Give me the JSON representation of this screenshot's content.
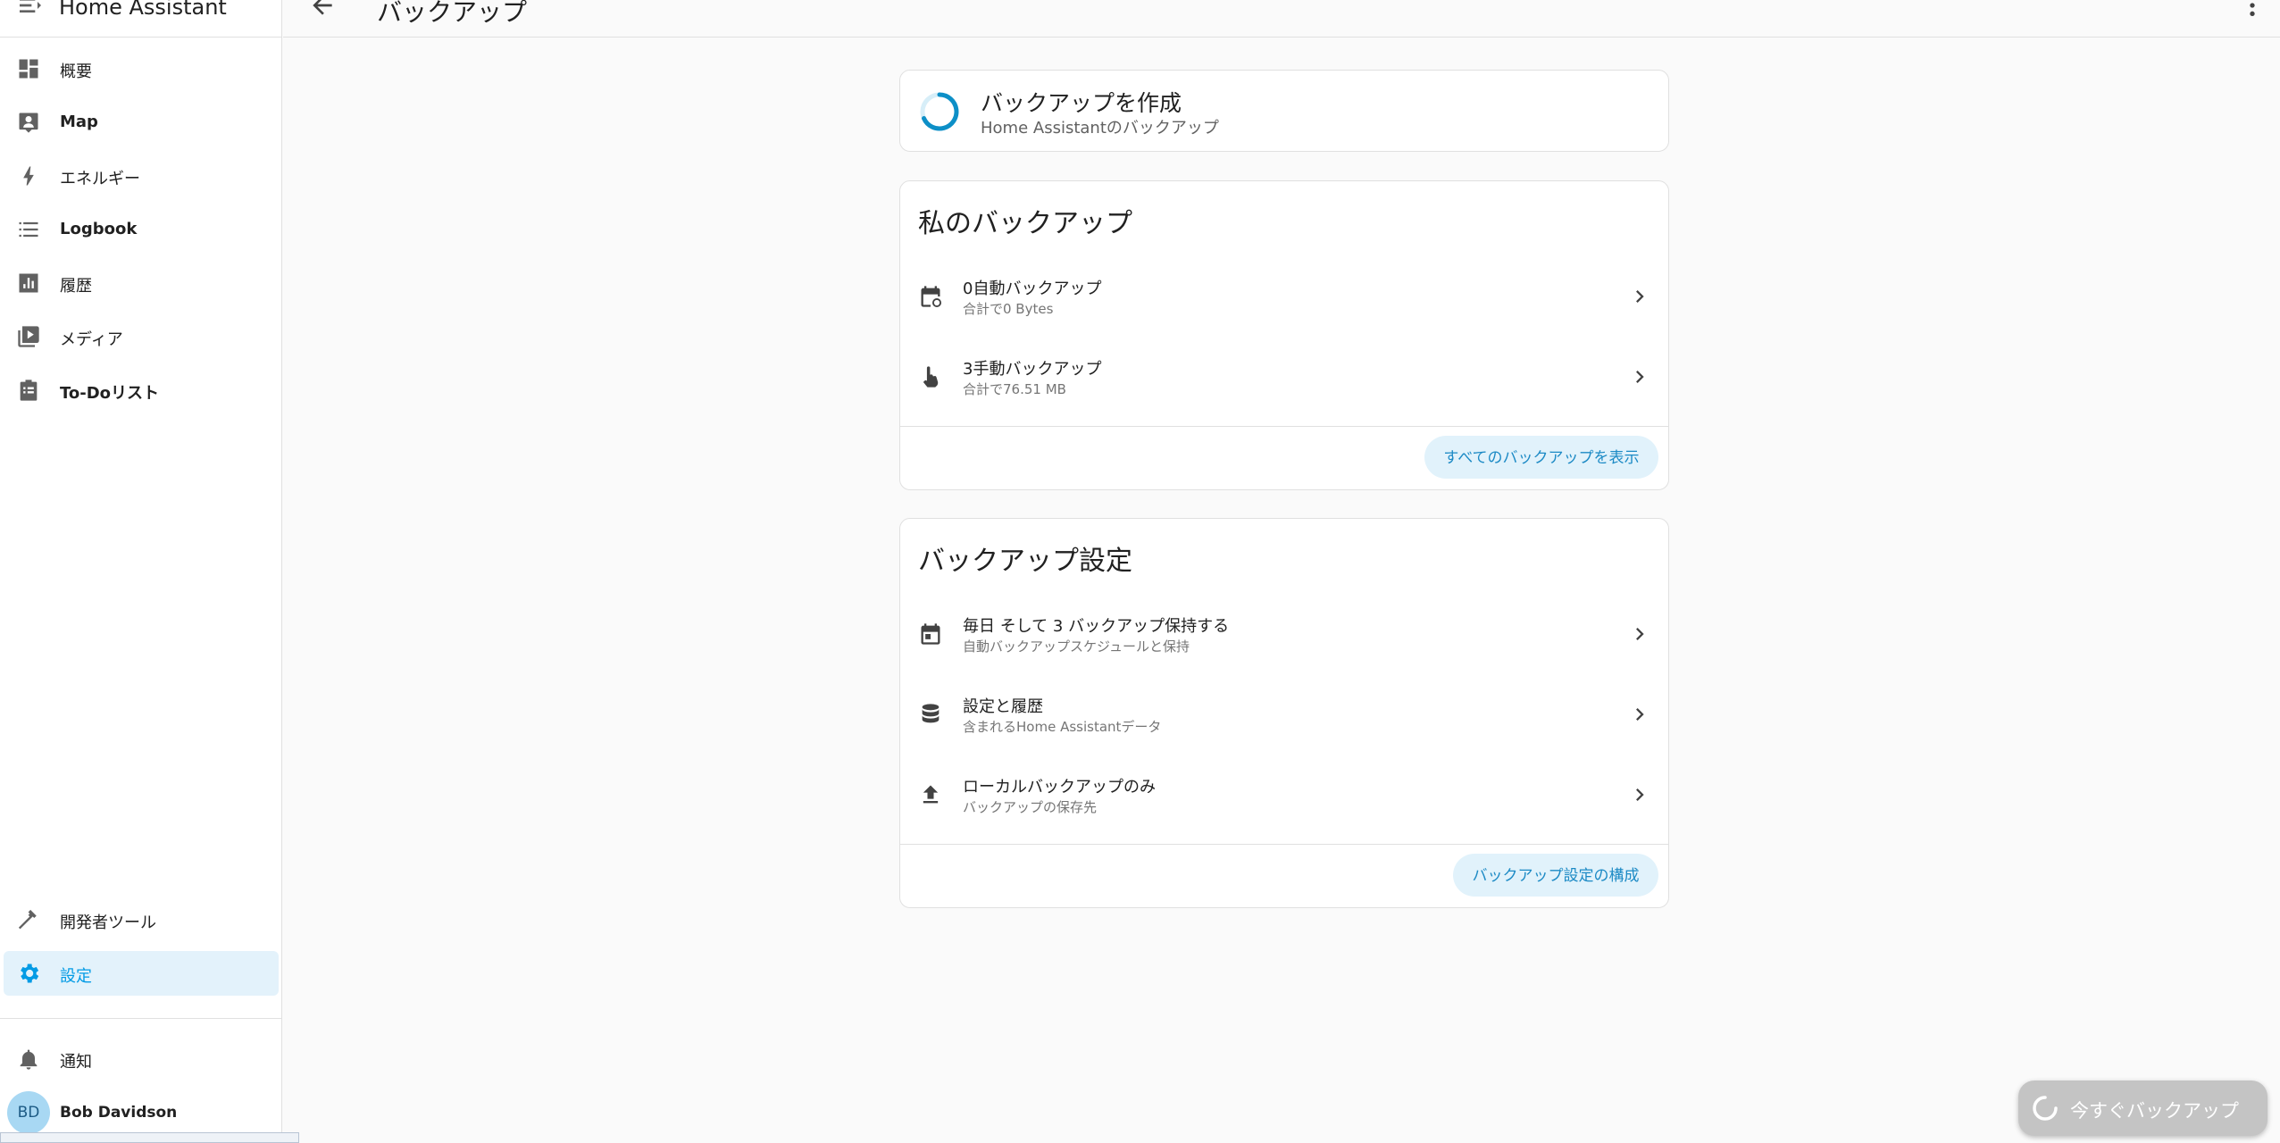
{
  "app": {
    "title": "Home Assistant"
  },
  "sidebar": {
    "items": [
      {
        "label": "概要",
        "icon": "dashboard-icon"
      },
      {
        "label": "Map",
        "icon": "map-icon"
      },
      {
        "label": "エネルギー",
        "icon": "lightning-icon"
      },
      {
        "label": "Logbook",
        "icon": "list-icon"
      },
      {
        "label": "履歴",
        "icon": "chart-icon"
      },
      {
        "label": "メディア",
        "icon": "media-icon"
      },
      {
        "label": "To-Doリスト",
        "icon": "clipboard-icon"
      }
    ],
    "bottom_items": [
      {
        "label": "開発者ツール",
        "icon": "hammer-icon"
      },
      {
        "label": "設定",
        "icon": "gear-icon",
        "active": true
      }
    ],
    "notifications_label": "通知",
    "user": {
      "initials": "BD",
      "name": "Bob Davidson"
    }
  },
  "header": {
    "title": "バックアップ"
  },
  "create_card": {
    "title": "バックアップを作成",
    "subtitle": "Home Assistantのバックアップ"
  },
  "my_backups": {
    "title": "私のバックアップ",
    "rows": [
      {
        "title": "0自動バックアップ",
        "subtitle": "合計で0 Bytes"
      },
      {
        "title": "3手動バックアップ",
        "subtitle": "合計で76.51 MB"
      }
    ],
    "action_label": "すべてのバックアップを表示"
  },
  "backup_settings": {
    "title": "バックアップ設定",
    "rows": [
      {
        "title": "毎日 そして 3 バックアップ保持する",
        "subtitle": "自動バックアップスケジュールと保持"
      },
      {
        "title": "設定と履歴",
        "subtitle": "含まれるHome Assistantデータ"
      },
      {
        "title": "ローカルバックアップのみ",
        "subtitle": "バックアップの保存先"
      }
    ],
    "action_label": "バックアップ設定の構成"
  },
  "fab": {
    "label": "今すぐバックアップ"
  },
  "colors": {
    "accent": "#039be5",
    "active_bg": "#e3f2fb",
    "pill_bg": "#e1f2fb",
    "fab_bg": "#c4c4c4"
  }
}
